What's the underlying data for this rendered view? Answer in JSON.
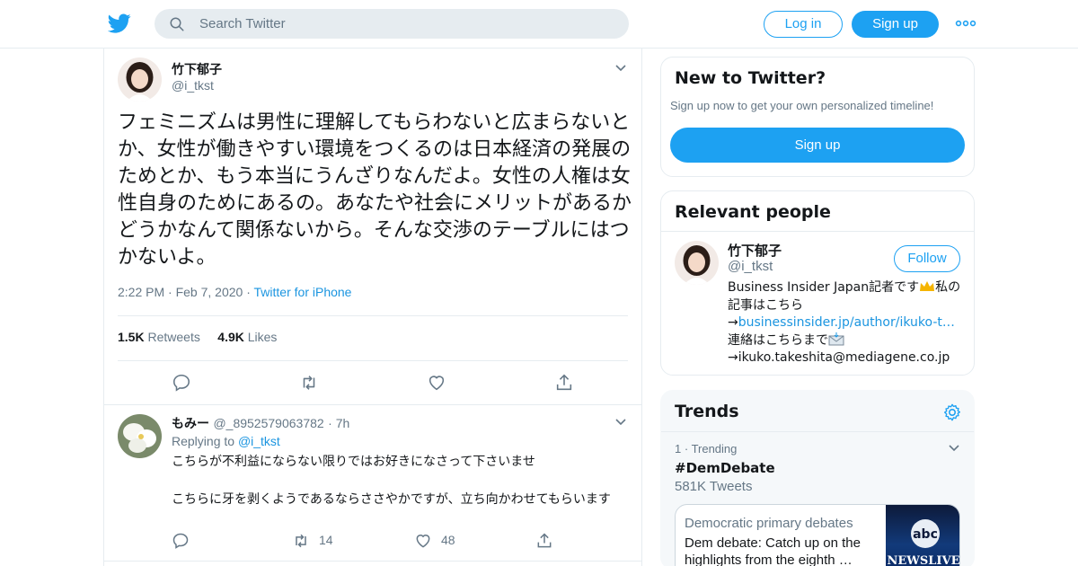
{
  "header": {
    "search_placeholder": "Search Twitter",
    "login_label": "Log in",
    "signup_label": "Sign up",
    "brand_color": "#1da1f2"
  },
  "tweet": {
    "author_name": "竹下郁子",
    "author_handle": "@i_tkst",
    "text": "フェミニズムは男性に理解してもらわないと広まらないとか、女性が働きやすい環境をつくるのは日本経済の発展のためとか、もう本当にうんざりなんだよ。女性の人権は女性自身のためにあるの。あなたや社会にメリットがあるかどうかなんて関係ないから。そんな交渉のテーブルにはつかないよ。",
    "time": "2:22 PM",
    "date": "Feb 7, 2020",
    "source": "Twitter for iPhone",
    "retweets_count": "1.5K",
    "retweets_label": "Retweets",
    "likes_count": "4.9K",
    "likes_label": "Likes"
  },
  "reply": {
    "author_name": "もみー",
    "author_handle": "@_8952579063782",
    "age": "7h",
    "replying_prefix": "Replying to",
    "replying_to": "@i_tkst",
    "text": "こちらが不利益にならない限りではお好きになさって下さいませ\n\nこちらに牙を剥くようであるならささやかですが、立ち向かわせてもらいます",
    "retweet_count": "14",
    "like_count": "48"
  },
  "new_to_twitter": {
    "title": "New to Twitter?",
    "subtitle": "Sign up now to get your own personalized timeline!",
    "button_label": "Sign up"
  },
  "relevant_people": {
    "title": "Relevant people",
    "name": "竹下郁子",
    "handle": "@i_tkst",
    "follow_label": "Follow",
    "bio_part1": "Business Insider Japan記者です",
    "bio_part2": "私の記事はこちら→",
    "bio_link": "businessinsider.jp/author/ikuko-t…",
    "bio_part3": " 連絡はこちらまで",
    "bio_part4": "→ikuko.takeshita@mediagene.co.jp"
  },
  "trends": {
    "title": "Trends",
    "rank": "1",
    "rank_label": "Trending",
    "tag": "#DemDebate",
    "count": "581K Tweets",
    "news_category": "Democratic primary debates",
    "news_headline": "Dem debate: Catch up on the highlights from the eighth …",
    "thumb_logo": "abc",
    "thumb_label": "NEWSLIVE"
  }
}
